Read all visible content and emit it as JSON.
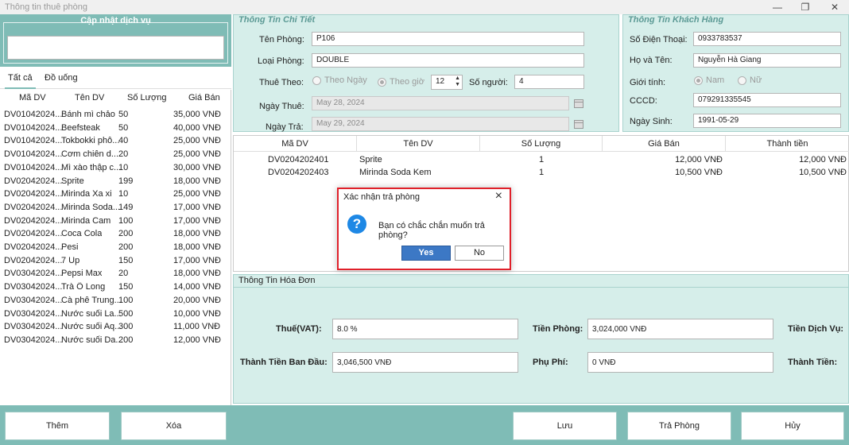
{
  "window": {
    "title": "Thông tin thuê phòng",
    "min": "—",
    "max": "❐",
    "close": "✕"
  },
  "left": {
    "update_title": "Cập nhật dịch vụ",
    "search_value": "",
    "tabs": [
      "Tất cả",
      "Đồ uống"
    ],
    "headers": [
      "Mã DV",
      "Tên DV",
      "Số Lượng",
      "Giá Bán"
    ],
    "rows": [
      [
        "DV01042024...",
        "Bánh mì chảo",
        "50",
        "35,000 VNĐ"
      ],
      [
        "DV01042024...",
        "Beefsteak",
        "50",
        "40,000 VNĐ"
      ],
      [
        "DV01042024...",
        "Tokbokki phô...",
        "40",
        "25,000 VNĐ"
      ],
      [
        "DV01042024...",
        "Cơm chiên d...",
        "20",
        "25,000 VNĐ"
      ],
      [
        "DV01042024...",
        "Mì xào thập c...",
        "10",
        "30,000 VNĐ"
      ],
      [
        "DV02042024...",
        "Sprite",
        "199",
        "18,000 VNĐ"
      ],
      [
        "DV02042024...",
        "Mirinda Xa xi",
        "10",
        "25,000 VNĐ"
      ],
      [
        "DV02042024...",
        "Mirinda Soda...",
        "149",
        "17,000 VNĐ"
      ],
      [
        "DV02042024...",
        "Mirinda Cam",
        "100",
        "17,000 VNĐ"
      ],
      [
        "DV02042024...",
        "Coca Cola",
        "200",
        "18,000 VNĐ"
      ],
      [
        "DV02042024...",
        "Pesi",
        "200",
        "18,000 VNĐ"
      ],
      [
        "DV02042024...",
        "7 Up",
        "150",
        "17,000 VNĐ"
      ],
      [
        "DV03042024...",
        "Pepsi Max",
        "20",
        "18,000 VNĐ"
      ],
      [
        "DV03042024...",
        "Trà Ô Long",
        "150",
        "14,000 VNĐ"
      ],
      [
        "DV03042024...",
        "Cà phê Trung...",
        "100",
        "20,000 VNĐ"
      ],
      [
        "DV03042024...",
        "Nước suối La...",
        "500",
        "10,000 VNĐ"
      ],
      [
        "DV03042024...",
        "Nước suối Aq...",
        "300",
        "11,000 VNĐ"
      ],
      [
        "DV03042024...",
        "Nước suối Da...",
        "200",
        "12,000 VNĐ"
      ]
    ]
  },
  "detail": {
    "title": "Thông Tin Chi Tiết",
    "room_label": "Tên Phòng:",
    "room_value": "P106",
    "type_label": "Loại Phòng:",
    "type_value": "DOUBLE",
    "rent_label": "Thuê Theo:",
    "rent_day": "Theo Ngày",
    "rent_hour": "Theo giờ",
    "hours_value": "12",
    "people_label": "Số người:",
    "people_value": "4",
    "checkin_label": "Ngày Thuê:",
    "checkin_value": "May 28, 2024",
    "checkout_label": "Ngày Trả:",
    "checkout_value": "May 29, 2024"
  },
  "customer": {
    "title": "Thông Tin Khách Hàng",
    "phone_label": "Số Điện Thoại:",
    "phone_value": "0933783537",
    "name_label": "Họ và Tên:",
    "name_value": "Nguyễn Hà Giang",
    "gender_label": "Giới tính:",
    "male": "Nam",
    "female": "Nữ",
    "id_label": "CCCD:",
    "id_value": "079291335545",
    "dob_label": "Ngày Sinh:",
    "dob_value": "1991-05-29"
  },
  "services": {
    "headers": [
      "Mã DV",
      "Tên DV",
      "Số Lượng",
      "Giá Bán",
      "Thành tiền"
    ],
    "rows": [
      [
        "DV0204202401",
        "Sprite",
        "1",
        "12,000 VNĐ",
        "12,000 VNĐ"
      ],
      [
        "DV0204202403",
        "Mirinda Soda Kem",
        "1",
        "10,500 VNĐ",
        "10,500 VNĐ"
      ]
    ]
  },
  "invoice": {
    "title": "Thông Tin Hóa Đơn",
    "vat_label": "Thuế(VAT):",
    "vat_value": "8.0 %",
    "room_fee_label": "Tiền Phòng:",
    "room_fee_value": "3,024,000 VNĐ",
    "service_fee_label": "Tiền Dịch Vụ:",
    "initial_label": "Thành Tiền Ban Đầu:",
    "initial_value": "3,046,500 VNĐ",
    "extra_label": "Phụ Phí:",
    "extra_value": "0 VNĐ",
    "total_label": "Thành Tiền:"
  },
  "buttons": {
    "add": "Thêm",
    "delete": "Xóa",
    "save": "Lưu",
    "checkout": "Trả Phòng",
    "cancel": "Hủy"
  },
  "dialog": {
    "title": "Xác nhận trả phòng",
    "message": "Bạn có chắc chắn muốn trả phòng?",
    "yes": "Yes",
    "no": "No"
  }
}
